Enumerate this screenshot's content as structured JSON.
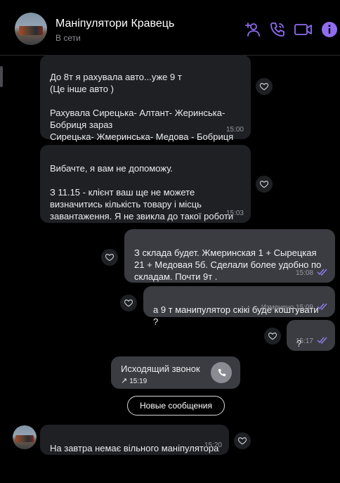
{
  "header": {
    "title": "Маніпулятори Кравець",
    "status": "В сети"
  },
  "messages": [
    {
      "text": "До 8т я рахувала авто...уже 9 т\n(Це інше авто )\n\nРахувала Сирецька- Алтант- Жеринська-Бобриця   зараз\nСирецька- Жмеринська- Медова - Бобриця",
      "time": "15:00"
    },
    {
      "text": "Вибачте, я вам не допоможу.\n\nЗ 11.15 - клієнт ваш ще не можете визначитись кількість товару і місць завантаження. Я не звикла до такої роботи",
      "time": "15:03"
    },
    {
      "text": "З склада будет. Жмеринская 1 + Сырецкая 21 + Медовая 5б. Сделали более удобно по складам. Почти 9т .",
      "time": "15:08"
    },
    {
      "text": "а 9 т манипулятор скікі буде коштувати ?",
      "time": "Изменено 15:09"
    },
    {
      "text": "?",
      "time": "15:17"
    },
    {
      "text": "На завтра немає вільного маніпулятора",
      "time": "15:20"
    }
  ],
  "call": {
    "label": "Исходящий звонок",
    "time": "15:19"
  },
  "new_messages_label": "Новые сообщения",
  "colors": {
    "accent": "#8f6cf0",
    "incoming_bubble": "#1f2024",
    "outgoing_bubble": "#3b3c42",
    "read_ticks": "#8f7ff0"
  },
  "icons": [
    "add-participant-icon",
    "voice-call-icon",
    "video-call-icon",
    "info-icon",
    "heart-icon",
    "double-check-icon",
    "phone-icon",
    "outgoing-call-arrow-icon"
  ]
}
